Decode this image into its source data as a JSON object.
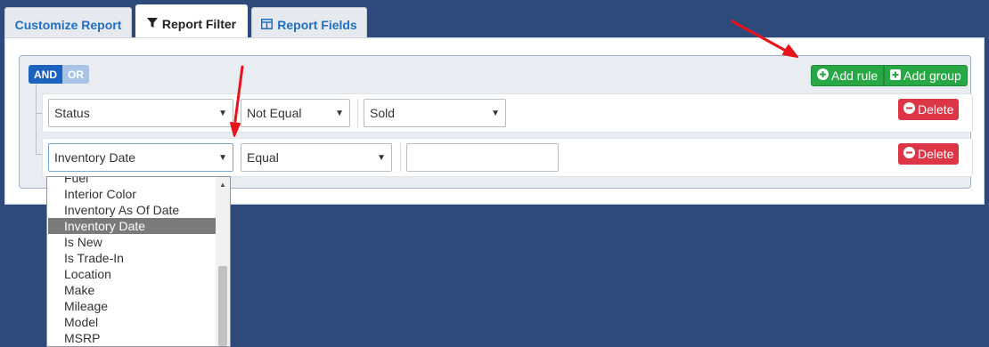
{
  "tabs": [
    {
      "label": "Customize Report",
      "icon": "none"
    },
    {
      "label": "Report Filter",
      "icon": "filter-icon"
    },
    {
      "label": "Report Fields",
      "icon": "table-icon"
    }
  ],
  "active_tab": "Report Filter",
  "group": {
    "and_label": "AND",
    "or_label": "OR",
    "add_rule_label": "Add rule",
    "add_group_label": "Add group"
  },
  "rules": [
    {
      "field": "Status",
      "operator": "Not Equal",
      "value": "Sold",
      "delete_label": "Delete"
    },
    {
      "field": "Inventory Date",
      "operator": "Equal",
      "value": "",
      "delete_label": "Delete"
    }
  ],
  "dropdown": {
    "items": [
      "Fuel",
      "Interior Color",
      "Inventory As Of Date",
      "Inventory Date",
      "Is New",
      "Is Trade-In",
      "Location",
      "Make",
      "Mileage",
      "Model",
      "MSRP"
    ],
    "selected": "Inventory Date"
  },
  "colors": {
    "background": "#2d4a7a",
    "primary": "#1c63bd",
    "success": "#28a745",
    "danger": "#dc3545",
    "annotation_arrow": "#e8141b"
  }
}
